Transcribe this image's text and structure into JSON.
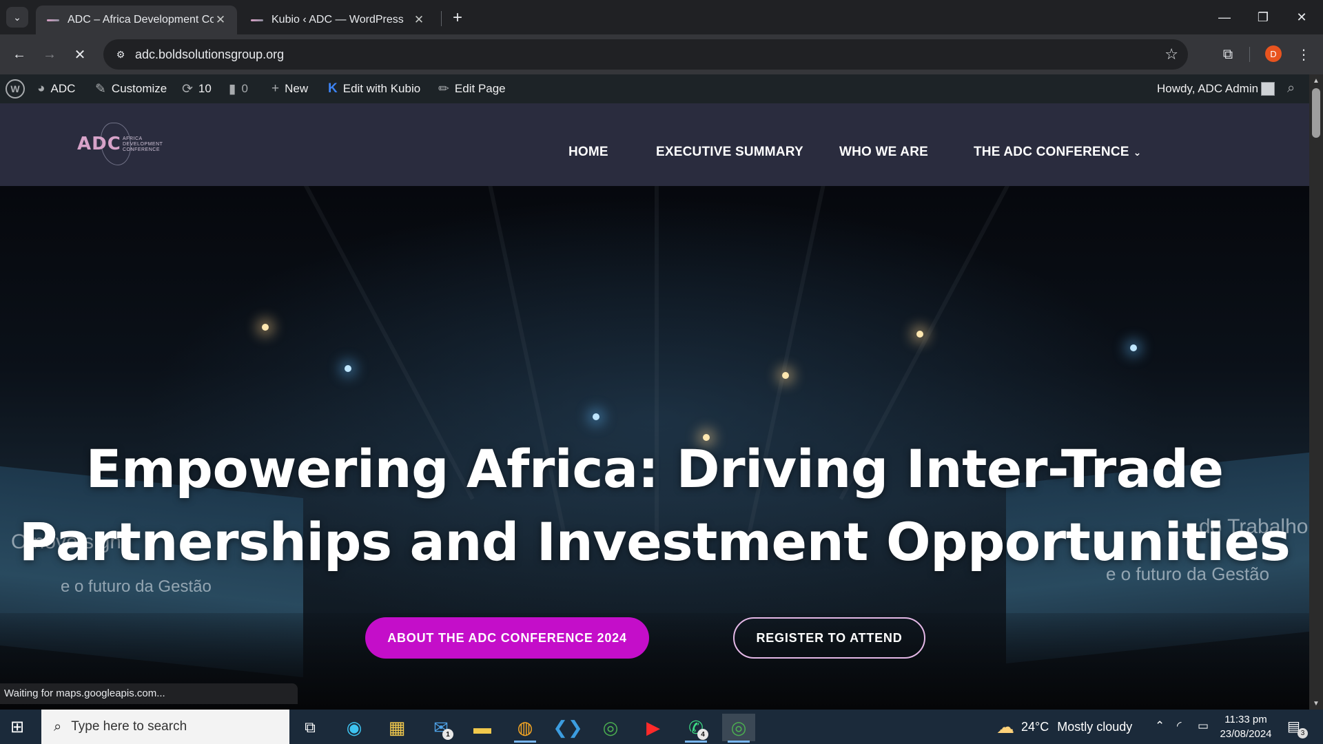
{
  "browser": {
    "tabs": [
      {
        "title": "ADC – Africa Development Con",
        "active": true
      },
      {
        "title": "Kubio ‹ ADC — WordPress",
        "active": false
      }
    ],
    "url": "adc.boldsolutionsgroup.org",
    "profile_initial": "D",
    "status_text": "Waiting for maps.googleapis.com..."
  },
  "wp_admin_bar": {
    "site_name": "ADC",
    "customize": "Customize",
    "updates_count": "10",
    "comments_count": "0",
    "new": "New",
    "edit_with_kubio": "Edit with Kubio",
    "edit_page": "Edit Page",
    "howdy": "Howdy, ADC Admin"
  },
  "site_header": {
    "logo_text": "ADC",
    "logo_sub": [
      "AFRICA",
      "DEVELOPMENT",
      "CONFERENCE"
    ],
    "menu": [
      {
        "label": "HOME"
      },
      {
        "label": "EXECUTIVE SUMMARY"
      },
      {
        "label": "WHO WE ARE"
      },
      {
        "label": "THE ADC CONFERENCE",
        "has_dropdown": true
      }
    ]
  },
  "hero": {
    "title_line1": "Empowering Africa: Driving Inter-Trade",
    "title_line2": "Partnerships and Investment Opportunities",
    "primary_button": "ABOUT THE ADC CONFERENCE 2024",
    "secondary_button": "REGISTER TO ATTEND",
    "screen_texts": [
      "O novo sign",
      "e o futuro da Gestão",
      "do Trabalho",
      "e o futuro da Gestão"
    ]
  },
  "taskbar": {
    "search_placeholder": "Type here to search",
    "mail_badge": "1",
    "whatsapp_badge": "4",
    "weather_temp": "24°C",
    "weather_desc": "Mostly cloudy",
    "time": "11:33 pm",
    "date": "23/08/2024",
    "notification_count": "3"
  },
  "colors": {
    "primary_button": "#c40ec9",
    "header_bg": "#2a2c3e",
    "wp_bar_bg": "#1d2327"
  }
}
